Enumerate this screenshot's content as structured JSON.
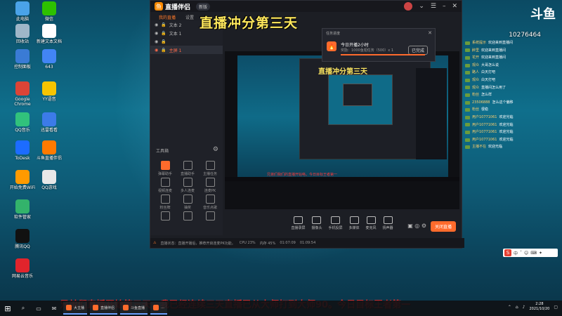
{
  "desktop_icons": [
    {
      "label": "此电脑",
      "icon": "computer-icon",
      "color": "#4aa3e8"
    },
    {
      "label": "微信",
      "icon": "wechat-icon",
      "color": "#2dc100"
    },
    {
      "label": "回收站",
      "icon": "recycle-bin-icon",
      "color": "#9fb6c8"
    },
    {
      "label": "新建文本文档",
      "icon": "text-file-icon",
      "color": "#ffffff"
    },
    {
      "label": "控制面板",
      "icon": "control-panel-icon",
      "color": "#3a7bd5"
    },
    {
      "label": "643",
      "icon": "chrome-icon",
      "color": "#4285f4"
    },
    {
      "label": "Google Chrome",
      "icon": "chrome-icon",
      "color": "#db4437"
    },
    {
      "label": "YY语音",
      "icon": "yy-icon",
      "color": "#f7c400"
    },
    {
      "label": "QQ音乐",
      "icon": "qq-music-icon",
      "color": "#31c27c"
    },
    {
      "label": "迅雷看看",
      "icon": "xunlei-icon",
      "color": "#3c7be8"
    },
    {
      "label": "ToDesk",
      "icon": "todesk-icon",
      "color": "#1c6cff"
    },
    {
      "label": "斗鱼直播伴侣",
      "icon": "douyu-icon",
      "color": "#ff7a00"
    },
    {
      "label": "开始免费WiFi",
      "icon": "wifi-icon",
      "color": "#ff9a00"
    },
    {
      "label": "QQ游戏",
      "icon": "qq-game-icon",
      "color": "#e8e8e8"
    },
    {
      "label": "软件管家",
      "icon": "software-manager-icon",
      "color": "#33b36b"
    },
    {
      "label": "腾讯QQ",
      "icon": "qq-icon",
      "color": "#111111"
    },
    {
      "label": "网易云音乐",
      "icon": "netease-music-icon",
      "color": "#e1242c"
    }
  ],
  "app": {
    "name": "直播伴侣",
    "version": "新版",
    "tabs": [
      "我的直播",
      "设置"
    ],
    "scenes": [
      "文本 2",
      "文本 1",
      "",
      "主屏 1"
    ],
    "tools_title": "工具箱",
    "tools": [
      "弹幕助手",
      "直播助手",
      "主播任务",
      "视频连麦",
      "多人连麦",
      "连麦PK",
      "粉丝牌",
      "抽奖",
      "音乐点歌",
      "",
      "",
      ""
    ],
    "bottom_buttons": [
      "直播录屏",
      "摄像头",
      "手机投屏",
      "多媒体",
      "麦克风",
      "扬声器"
    ],
    "live_button": "关闭直播",
    "status": {
      "warning": "直播状态：直播开播后，推荐开启连麦PK功能。",
      "cpu": "CPU 23%",
      "mem": "内存 45%",
      "time1": "01:07:09",
      "time2": "01:09:54"
    }
  },
  "popup": {
    "title": "任务进度",
    "main": "今日开播2小时",
    "sub": "奖励：1000鱼翅任务（500）x 1",
    "button": "已完成"
  },
  "overlay_title": "直播冲分第三天",
  "preview_overlay": "直播冲分第三天",
  "preview_red": "兄弟们我们的直播开始咯，今日目标王者第一",
  "chat": {
    "logo": "斗鱼",
    "count": "10276464",
    "messages": [
      {
        "user": "系统提示",
        "text": "欢迎来到直播间"
      },
      {
        "user": "醉里",
        "text": "欢迎来到直播间"
      },
      {
        "user": "花开",
        "text": "欢迎来到直播间"
      },
      {
        "user": "观众",
        "text": "大哥怎么说"
      },
      {
        "user": "路人",
        "text": "白天打吧"
      },
      {
        "user": "观众",
        "text": "白天打吧"
      },
      {
        "user": "观众",
        "text": "直播间怎么用了"
      },
      {
        "user": "粉丝",
        "text": "怎么样"
      },
      {
        "user": "23506888",
        "text": "怎么这个偏移"
      },
      {
        "user": "粉丝",
        "text": "很稳"
      },
      {
        "user": "用户10771061",
        "text": "欢迎光临"
      },
      {
        "user": "用户10771061",
        "text": "欢迎光临"
      },
      {
        "user": "用户10771061",
        "text": "欢迎光临"
      },
      {
        "user": "用户10771061",
        "text": "欢迎光临"
      },
      {
        "user": "主播不在",
        "text": "欢迎光临"
      }
    ]
  },
  "ime": {
    "label": "中",
    "items": [
      "ˇ",
      "☺",
      "⌨",
      "✦"
    ]
  },
  "marquee": "兄弟们直播开始第三天，我已经连续三天直播已从大师打到大师90。今日目标王者第一",
  "taskbar": {
    "apps": [
      "大主播",
      "直播伴侣",
      "斗鱼直播",
      "..."
    ],
    "clock_time": "2:28",
    "clock_date": "2021/10/20"
  }
}
